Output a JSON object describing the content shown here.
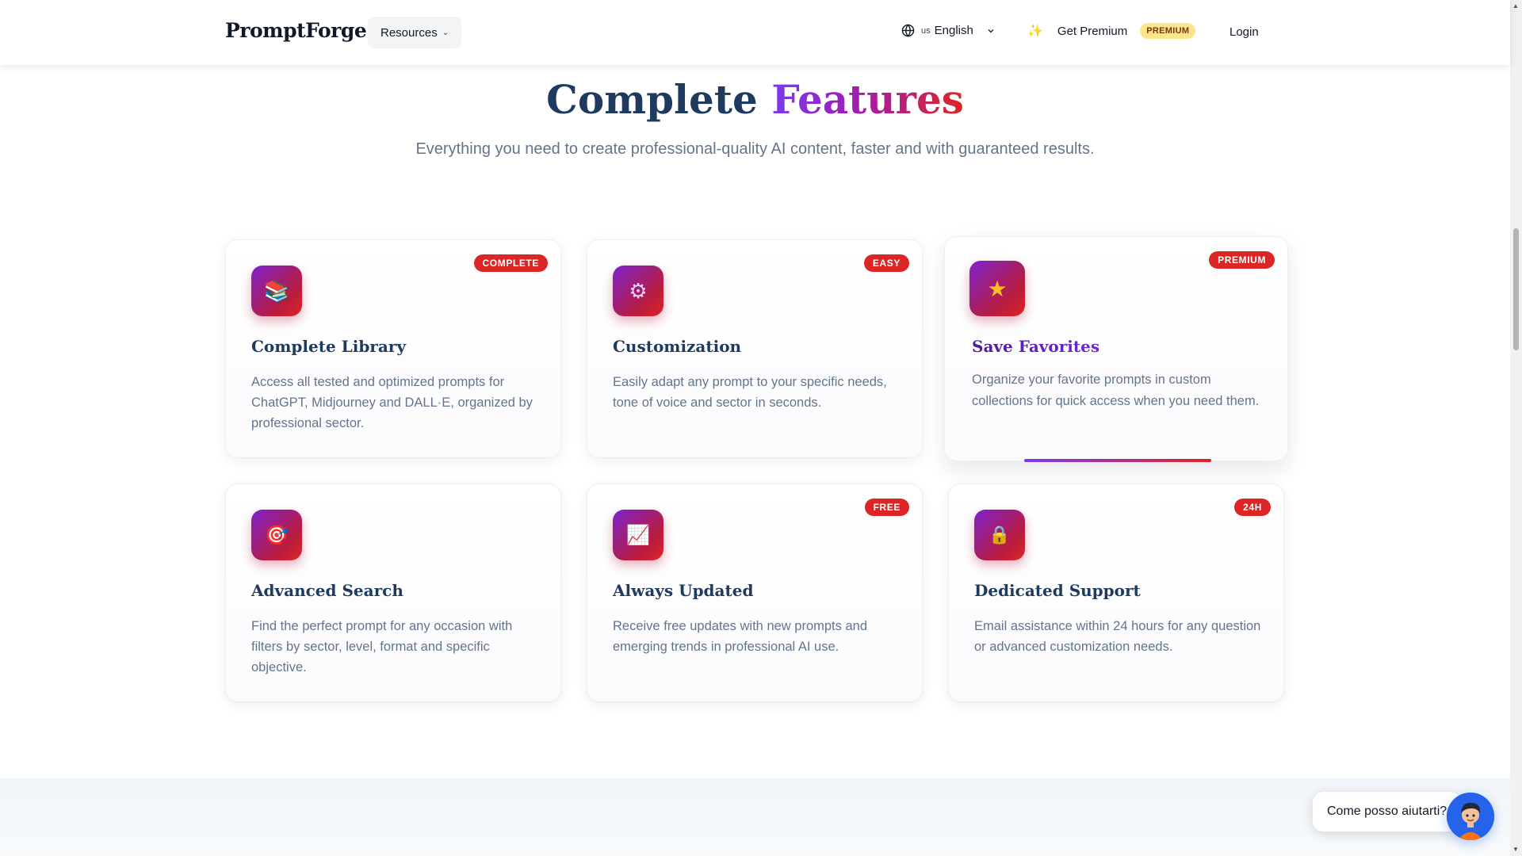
{
  "nav": {
    "brand": "PromptForge",
    "resources_label": "Resources",
    "language_code": "us",
    "language_label": "English",
    "premium_link_label": "Get Premium",
    "premium_pill": "PREMIUM",
    "login_label": "Login"
  },
  "section": {
    "title_plain": "Complete",
    "title_gradient": "Features",
    "subtitle": "Everything you need to create professional-quality AI content, faster and with guaranteed results."
  },
  "cards": [
    {
      "badge": "COMPLETE",
      "icon": "books-icon",
      "icon_glyph": "📚",
      "title": "Complete Library",
      "description": "Access all tested and optimized prompts for ChatGPT, Midjourney and DALL·E, organized by professional sector."
    },
    {
      "badge": "EASY",
      "icon": "gear-icon",
      "icon_glyph": "⚙",
      "title": "Customization",
      "description": "Easily adapt any prompt to your specific needs, tone of voice and sector in seconds."
    },
    {
      "badge": "PREMIUM",
      "icon": "star-icon",
      "icon_glyph": "★",
      "title": "Save Favorites",
      "description": "Organize your favorite prompts in custom collections for quick access when you need them."
    },
    {
      "badge": "",
      "icon": "target-icon",
      "icon_glyph": "🎯",
      "title": "Advanced Search",
      "description": "Find the perfect prompt for any occasion with filters by sector, level, format and specific objective."
    },
    {
      "badge": "FREE",
      "icon": "chart-icon",
      "icon_glyph": "📈",
      "title": "Always Updated",
      "description": "Receive free updates with new prompts and emerging trends in professional AI use."
    },
    {
      "badge": "24H",
      "icon": "lock-icon",
      "icon_glyph": "🔒",
      "title": "Dedicated Support",
      "description": "Email assistance within 24 hours for any question or advanced customization needs."
    }
  ],
  "chat": {
    "prompt": "Come posso aiutarti?"
  },
  "colors": {
    "brand_gradient_start": "#7c3aed",
    "brand_gradient_end": "#dc2626",
    "badge_red": "#dc2626",
    "premium_yellow": "#fde68a",
    "heading_navy": "#1e3a5f",
    "chat_blue": "#2563eb"
  }
}
